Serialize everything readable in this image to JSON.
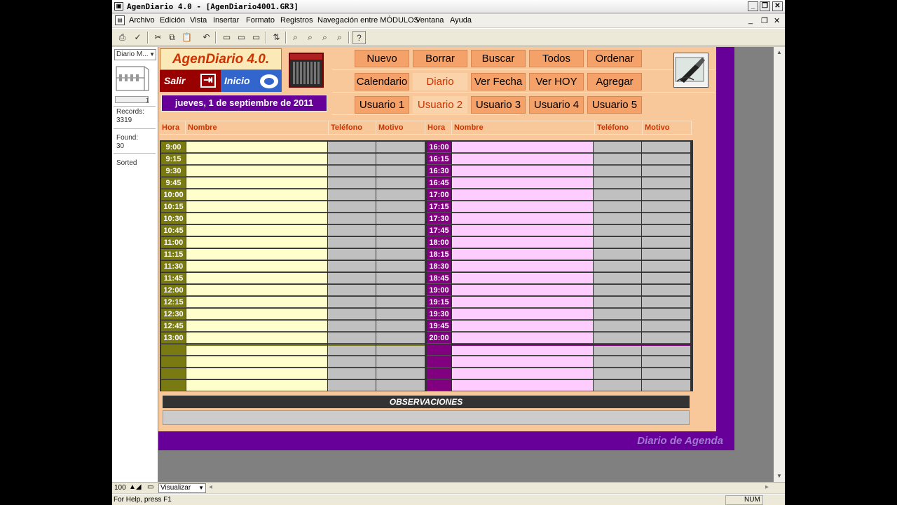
{
  "window": {
    "title": "AgenDiario 4.0 - [AgenDiario4001.GR3]"
  },
  "menu": [
    "Archivo",
    "Edición",
    "Vista",
    "Insertar",
    "Formato",
    "Registros",
    "Navegación entre MÓDULOS",
    "Ventana",
    "Ayuda"
  ],
  "status_area": {
    "layout_name": "Diario M...",
    "record_num": "1",
    "records_label": "Records:",
    "records_value": "3319",
    "found_label": "Found:",
    "found_value": "30",
    "sorted_label": "Sorted"
  },
  "layout": {
    "logo": "AgenDiario 4.0.",
    "salir": "Salir",
    "inicio": "Inicio",
    "date": "jueves, 1 de septiembre de 2011",
    "buttons_row1": [
      "Nuevo",
      "Borrar",
      "Buscar",
      "Todos",
      "Ordenar"
    ],
    "buttons_row2": [
      "Calendario",
      "Diario",
      "Ver Fecha",
      "Ver HOY",
      "Agregar"
    ],
    "buttons_row3": [
      "Usuario 1",
      "Usuario 2",
      "Usuario 3",
      "Usuario 4",
      "Usuario 5"
    ],
    "active_view": "Diario",
    "hover_button": "Usuario 2",
    "columns_left": [
      "Hora",
      "Nombre",
      "Teléfono",
      "Motivo"
    ],
    "columns_right": [
      "Hora",
      "Nombre",
      "Teléfono",
      "Motivo"
    ],
    "times_left": [
      "9:00",
      "9:15",
      "9:30",
      "9:45",
      "10:00",
      "10:15",
      "10:30",
      "10:45",
      "11:00",
      "11:15",
      "11:30",
      "11:45",
      "12:00",
      "12:15",
      "12:30",
      "12:45",
      "13:00",
      "",
      "",
      "",
      ""
    ],
    "times_right": [
      "16:00",
      "16:15",
      "16:30",
      "16:45",
      "17:00",
      "17:15",
      "17:30",
      "17:45",
      "18:00",
      "18:15",
      "18:30",
      "18:45",
      "19:00",
      "19:15",
      "19:30",
      "19:45",
      "20:00",
      "",
      "",
      "",
      ""
    ],
    "observaciones": "OBSERVACIONES",
    "footer_title": "Diario de Agenda"
  },
  "colors": {
    "morning_time": "#7a7a12",
    "morning_name": "#ffffcc",
    "afternoon_time": "#800080",
    "afternoon_name": "#ffccff",
    "empty_cell": "#c0c0c0",
    "accent_purple": "#660099",
    "panel_orange": "#f9c89a"
  },
  "bottom_bar": {
    "zoom": "100",
    "mode": "Visualizar"
  },
  "statusbar": {
    "help": "For Help, press F1",
    "num": "NUM"
  }
}
